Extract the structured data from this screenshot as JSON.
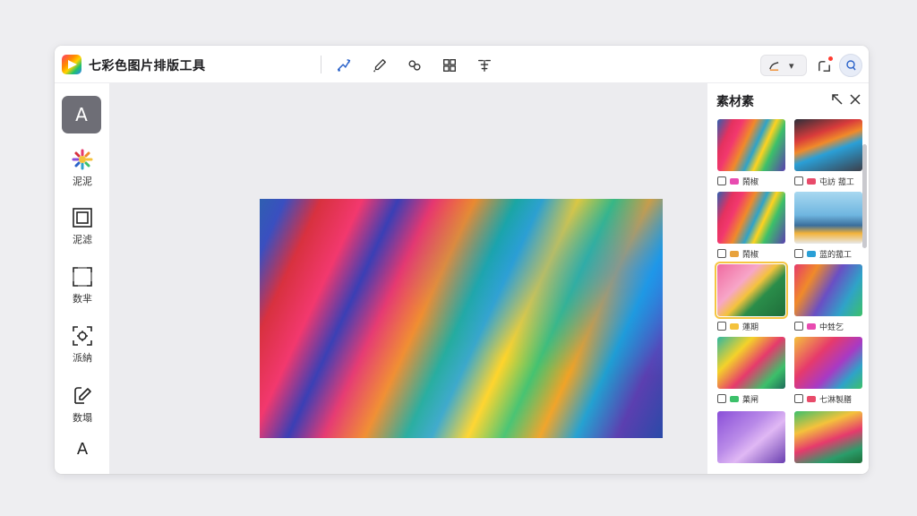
{
  "app": {
    "title": "七彩色图片排版工具"
  },
  "header": {
    "tools": [
      {
        "name": "pen-tool-icon"
      },
      {
        "name": "brush-icon"
      },
      {
        "name": "shapes-icon"
      },
      {
        "name": "grid-icon"
      },
      {
        "name": "transform-icon"
      }
    ],
    "pen_dropdown_chevron": "▾"
  },
  "sidebar": {
    "active_label": "A",
    "items": [
      {
        "label": "泥泥",
        "icon": "color-burst-icon"
      },
      {
        "label": "泥滤",
        "icon": "frame-icon"
      },
      {
        "label": "数芈",
        "icon": "crop-icon"
      },
      {
        "label": "派納",
        "icon": "focus-icon"
      },
      {
        "label": "数塌",
        "icon": "edit-icon"
      }
    ],
    "bottom_label": "A"
  },
  "panel": {
    "title": "素材素",
    "thumbnails": [
      {
        "caption": "鬧椒",
        "style": "g-rainbow",
        "selected": false,
        "tag_color": "#e84bb0"
      },
      {
        "caption": "屯訪 菰工",
        "style": "g-people",
        "selected": false,
        "tag_color": "#e84b6a"
      },
      {
        "caption": "鬧椒",
        "style": "g-rainbow",
        "selected": false,
        "tag_color": "#e8a23c"
      },
      {
        "caption": "蓝的菰工",
        "style": "g-people2",
        "selected": false,
        "tag_color": "#2a9fd6"
      },
      {
        "caption": "蓮期",
        "style": "g-pink",
        "selected": true,
        "tag_color": "#f4c23c"
      },
      {
        "caption": "中甡乞",
        "style": "g-rainbow2",
        "selected": false,
        "tag_color": "#e84bb0"
      },
      {
        "caption": "菓闸",
        "style": "g-fold",
        "selected": false,
        "tag_color": "#3cc06a"
      },
      {
        "caption": "七淋製膳",
        "style": "g-stripe",
        "selected": false,
        "tag_color": "#e84b6a"
      },
      {
        "caption": "",
        "style": "g-purple",
        "selected": false,
        "tag_color": "#8a4fd8"
      },
      {
        "caption": "",
        "style": "g-green",
        "selected": false,
        "tag_color": "#3cc06a"
      }
    ]
  }
}
